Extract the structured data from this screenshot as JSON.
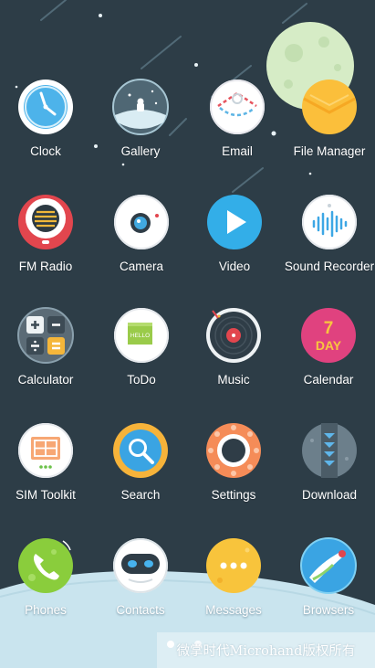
{
  "home_screen": {
    "rows": [
      [
        {
          "name": "Clock",
          "icon": "clock-icon"
        },
        {
          "name": "Gallery",
          "icon": "gallery-icon"
        },
        {
          "name": "Email",
          "icon": "email-icon"
        },
        {
          "name": "File Manager",
          "icon": "file-manager-icon"
        }
      ],
      [
        {
          "name": "FM Radio",
          "icon": "fm-radio-icon"
        },
        {
          "name": "Camera",
          "icon": "camera-icon"
        },
        {
          "name": "Video",
          "icon": "video-icon"
        },
        {
          "name": "Sound Recorder",
          "icon": "sound-recorder-icon"
        }
      ],
      [
        {
          "name": "Calculator",
          "icon": "calculator-icon"
        },
        {
          "name": "ToDo",
          "icon": "todo-icon"
        },
        {
          "name": "Music",
          "icon": "music-icon"
        },
        {
          "name": "Calendar",
          "icon": "calendar-icon"
        }
      ],
      [
        {
          "name": "SIM Toolkit",
          "icon": "sim-toolkit-icon"
        },
        {
          "name": "Search",
          "icon": "search-icon"
        },
        {
          "name": "Settings",
          "icon": "settings-icon"
        },
        {
          "name": "Download",
          "icon": "download-icon"
        }
      ]
    ],
    "dock": [
      {
        "name": "Phones",
        "icon": "phone-icon"
      },
      {
        "name": "Contacts",
        "icon": "contacts-icon"
      },
      {
        "name": "Messages",
        "icon": "messages-icon"
      },
      {
        "name": "Browsers",
        "icon": "browser-icon"
      }
    ],
    "icon_text": {
      "todo_note": "HELLO",
      "calendar_glyph": "7",
      "calendar_day": "DAY"
    },
    "page_indicator": {
      "pages": 2,
      "current": 1
    },
    "watermark": "微掌时代Microhand版权所有",
    "colors": {
      "background": "#2d3d47",
      "ground": "#c9e4ee",
      "moon": "#d6ecc6",
      "label": "#ffffff"
    }
  }
}
